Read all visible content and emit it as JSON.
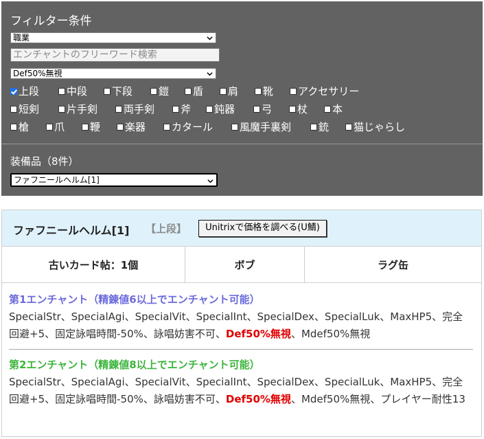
{
  "filter": {
    "title": "フィルター条件",
    "job_select": "職業",
    "search_placeholder": "エンチャントのフリーワード検索",
    "enchant_select": "Def50%無視",
    "checkbox_rows": [
      [
        {
          "label": "上段",
          "checked": true
        },
        {
          "label": "中段",
          "checked": false
        },
        {
          "label": "下段",
          "checked": false
        },
        {
          "label": "鎧",
          "checked": false
        },
        {
          "label": "盾",
          "checked": false
        },
        {
          "label": "肩",
          "checked": false
        },
        {
          "label": "靴",
          "checked": false
        },
        {
          "label": "アクセサリー",
          "checked": false
        }
      ],
      [
        {
          "label": "短剣",
          "checked": false
        },
        {
          "label": "片手剣",
          "checked": false
        },
        {
          "label": "両手剣",
          "checked": false
        },
        {
          "label": "斧",
          "checked": false
        },
        {
          "label": "鈍器",
          "checked": false
        },
        {
          "label": "弓",
          "checked": false
        },
        {
          "label": "杖",
          "checked": false
        },
        {
          "label": "本",
          "checked": false
        }
      ],
      [
        {
          "label": "槍",
          "checked": false
        },
        {
          "label": "爪",
          "checked": false
        },
        {
          "label": "鞭",
          "checked": false
        },
        {
          "label": "楽器",
          "checked": false
        },
        {
          "label": "カタール",
          "checked": false
        },
        {
          "label": "風魔手裏剣",
          "checked": false
        },
        {
          "label": "銃",
          "checked": false
        },
        {
          "label": "猫じゃらし",
          "checked": false
        }
      ]
    ],
    "equipment_label": "装備品（8件）",
    "equipment_select": "ファフニールヘルム[1]"
  },
  "item": {
    "name": "ファフニールヘルム[1]",
    "slot": "【上段】",
    "price_button": "Unitrixで価格を調べる(U鯖)",
    "sources": [
      "古いカード帖：1個",
      "ボブ",
      "ラグ缶"
    ],
    "enchant1": {
      "title": "第1エンチャント（精錬値6以上でエンチャント可能）",
      "text_before": "SpecialStr、SpecialAgi、SpecialVit、SpecialInt、SpecialDex、SpecialLuk、MaxHP5、完全回避+5、固定詠唱時間-50%、詠唱妨害不可、",
      "highlight": "Def50%無視",
      "text_after": "、Mdef50%無視"
    },
    "enchant2": {
      "title": "第2エンチャント（精錬値8以上でエンチャント可能）",
      "text_before": "SpecialStr、SpecialAgi、SpecialVit、SpecialInt、SpecialDex、SpecialLuk、MaxHP5、完全回避+5、固定詠唱時間-50%、詠唱妨害不可、",
      "highlight": "Def50%無視",
      "text_after": "、Mdef50%無視、プレイヤー耐性13"
    }
  },
  "colors": {
    "panel_bg": "#626262",
    "header_bg": "#dff2fc",
    "enchant1_title": "#6b6bdc",
    "enchant2_title": "#3cb43c",
    "highlight": "#e00000"
  }
}
